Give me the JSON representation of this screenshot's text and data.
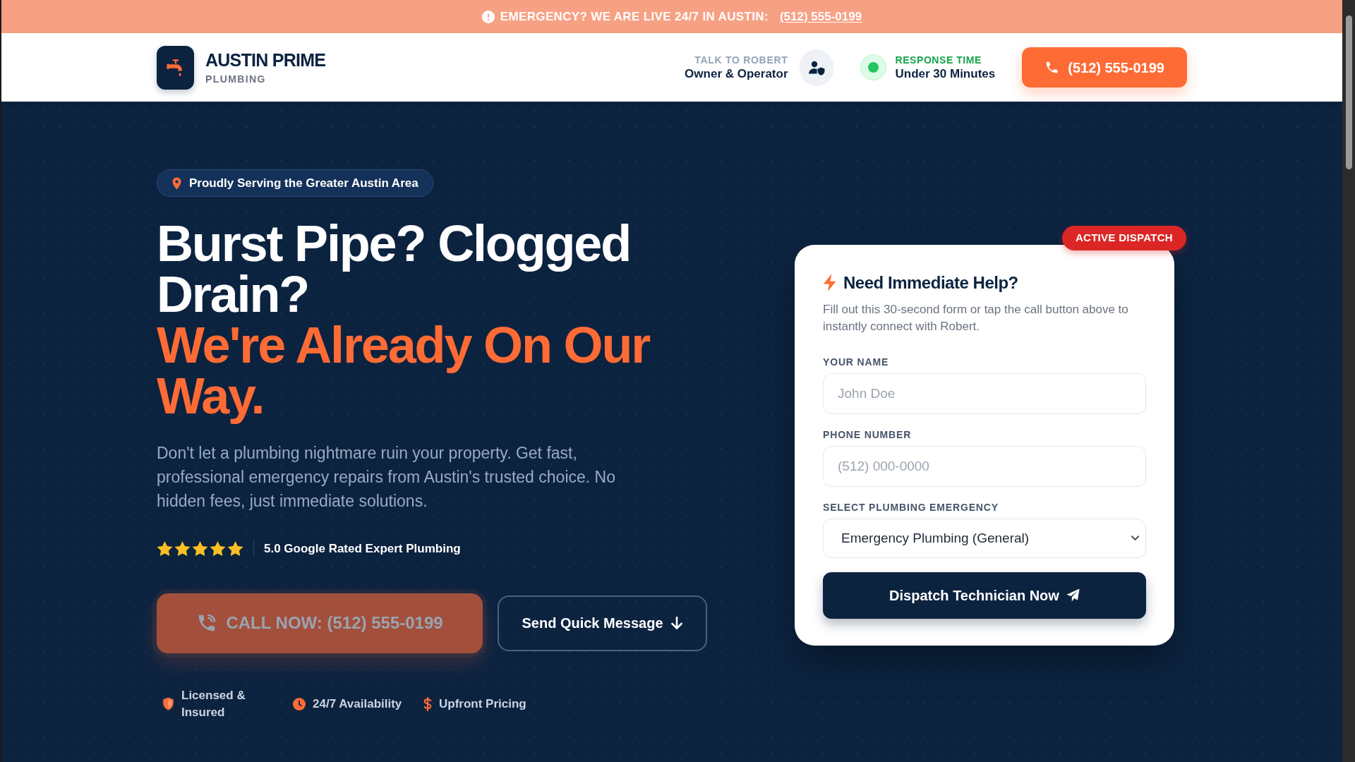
{
  "alert_bar": {
    "text": "EMERGENCY? WE ARE LIVE 24/7 IN AUSTIN:",
    "link": "(512) 555-0199"
  },
  "header": {
    "brand": {
      "name": "AUSTIN PRIME",
      "tagline": "PLUMBING"
    },
    "contact": {
      "label": "TALK TO ROBERT",
      "role": "Owner & Operator"
    },
    "response": {
      "label": "RESPONSE TIME",
      "value": "Under 30 Minutes"
    },
    "call_button": "(512) 555-0199"
  },
  "hero": {
    "location_badge": "Proudly Serving the Greater Austin Area",
    "headline": [
      {
        "text": "Burst Pipe? Clogged Drain?",
        "accent": false
      },
      {
        "text": "We're Already On Our Way.",
        "accent": true
      }
    ],
    "description": "Don't let a plumbing nightmare ruin your property. Get fast, professional emergency repairs from Austin's trusted choice. No hidden fees, just immediate solutions.",
    "rating": {
      "stars": 5,
      "text": "5.0 Google Rated Expert Plumbing"
    },
    "buttons": [
      {
        "kind": "call",
        "label": "CALL NOW: (512) 555-0199"
      },
      {
        "kind": "outline",
        "label": "Send Quick Message"
      }
    ],
    "features": [
      {
        "text": "Licensed & Insured"
      },
      {
        "text": "24/7 Availability"
      },
      {
        "text": "Upfront Pricing"
      }
    ]
  },
  "form": {
    "badge": "ACTIVE DISPATCH",
    "title": "Need Immediate Help?",
    "description": "Fill out this 30-second form or tap the call button above to instantly connect with Robert.",
    "fields": [
      {
        "kind": "input",
        "label": "YOUR NAME",
        "placeholder": "John Doe"
      },
      {
        "kind": "input",
        "label": "PHONE NUMBER",
        "placeholder": "(512) 000-0000"
      },
      {
        "kind": "select",
        "label": "SELECT PLUMBING EMERGENCY",
        "value": "Emergency Plumbing (General)"
      }
    ],
    "submit": "Dispatch Technician Now"
  }
}
